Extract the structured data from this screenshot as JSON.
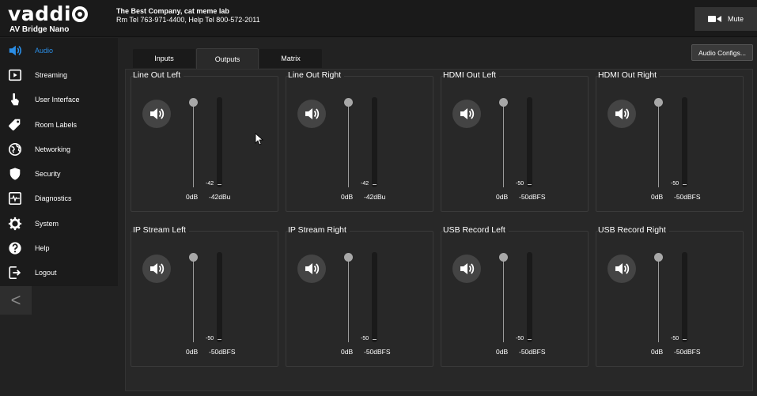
{
  "header": {
    "logo_text": "vaddi",
    "product": "AV Bridge Nano",
    "company": "The Best Company, cat meme lab",
    "contact": "Rm Tel 763-971-4400, Help Tel 800-572-2011",
    "mute_label": "Mute"
  },
  "sidebar": {
    "items": [
      {
        "label": "Audio",
        "icon": "speaker-icon",
        "active": true
      },
      {
        "label": "Streaming",
        "icon": "play-icon"
      },
      {
        "label": "User Interface",
        "icon": "touch-hand-icon"
      },
      {
        "label": "Room Labels",
        "icon": "tag-icon"
      },
      {
        "label": "Networking",
        "icon": "globe-icon"
      },
      {
        "label": "Security",
        "icon": "shield-icon"
      },
      {
        "label": "Diagnostics",
        "icon": "pulse-icon"
      },
      {
        "label": "System",
        "icon": "gear-icon"
      },
      {
        "label": "Help",
        "icon": "question-icon"
      },
      {
        "label": "Logout",
        "icon": "logout-icon"
      }
    ],
    "collapse_label": "<"
  },
  "tabs": [
    {
      "label": "Inputs"
    },
    {
      "label": "Outputs",
      "active": true
    },
    {
      "label": "Matrix"
    }
  ],
  "audio_configs_label": "Audio Configs...",
  "channels": [
    {
      "name": "Line Out Left",
      "meter_value": "-42",
      "gain": "0dB",
      "level": "-42dBu"
    },
    {
      "name": "Line Out Right",
      "meter_value": "-42",
      "gain": "0dB",
      "level": "-42dBu"
    },
    {
      "name": "HDMI Out Left",
      "meter_value": "-50",
      "gain": "0dB",
      "level": "-50dBFS"
    },
    {
      "name": "HDMI Out Right",
      "meter_value": "-50",
      "gain": "0dB",
      "level": "-50dBFS"
    },
    {
      "name": "IP Stream Left",
      "meter_value": "-50",
      "gain": "0dB",
      "level": "-50dBFS"
    },
    {
      "name": "IP Stream Right",
      "meter_value": "-50",
      "gain": "0dB",
      "level": "-50dBFS"
    },
    {
      "name": "USB Record Left",
      "meter_value": "-50",
      "gain": "0dB",
      "level": "-50dBFS"
    },
    {
      "name": "USB Record Right",
      "meter_value": "-50",
      "gain": "0dB",
      "level": "-50dBFS"
    }
  ],
  "colors": {
    "accent": "#2b8ee6",
    "background": "#222222",
    "panel": "#282828"
  }
}
